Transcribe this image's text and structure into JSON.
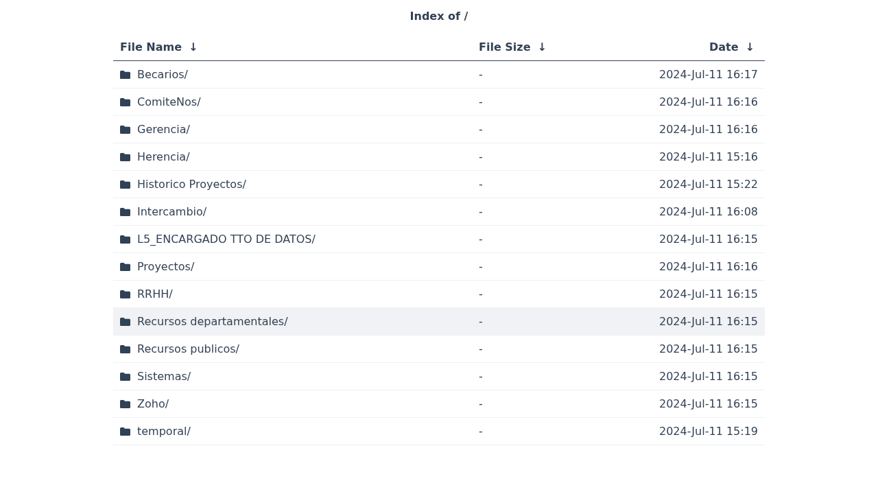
{
  "title": "Index of /",
  "table": {
    "columns": [
      {
        "label": "File Name",
        "sort": "↓"
      },
      {
        "label": "File Size",
        "sort": "↓"
      },
      {
        "label": "Date",
        "sort": "↓"
      }
    ],
    "rows": [
      {
        "name": "Becarios/",
        "size": "-",
        "date": "2024-Jul-11 16:17",
        "highlighted": false
      },
      {
        "name": "ComiteNos/",
        "size": "-",
        "date": "2024-Jul-11 16:16",
        "highlighted": false
      },
      {
        "name": "Gerencia/",
        "size": "-",
        "date": "2024-Jul-11 16:16",
        "highlighted": false
      },
      {
        "name": "Herencia/",
        "size": "-",
        "date": "2024-Jul-11 15:16",
        "highlighted": false
      },
      {
        "name": "Historico Proyectos/",
        "size": "-",
        "date": "2024-Jul-11 15:22",
        "highlighted": false
      },
      {
        "name": "Intercambio/",
        "size": "-",
        "date": "2024-Jul-11 16:08",
        "highlighted": false
      },
      {
        "name": "L5_ENCARGADO TTO DE DATOS/",
        "size": "-",
        "date": "2024-Jul-11 16:15",
        "highlighted": false
      },
      {
        "name": "Proyectos/",
        "size": "-",
        "date": "2024-Jul-11 16:16",
        "highlighted": false
      },
      {
        "name": "RRHH/",
        "size": "-",
        "date": "2024-Jul-11 16:15",
        "highlighted": false
      },
      {
        "name": "Recursos departamentales/",
        "size": "-",
        "date": "2024-Jul-11 16:15",
        "highlighted": true
      },
      {
        "name": "Recursos publicos/",
        "size": "-",
        "date": "2024-Jul-11 16:15",
        "highlighted": false
      },
      {
        "name": "Sistemas/",
        "size": "-",
        "date": "2024-Jul-11 16:15",
        "highlighted": false
      },
      {
        "name": "Zoho/",
        "size": "-",
        "date": "2024-Jul-11 16:15",
        "highlighted": false
      },
      {
        "name": "temporal/",
        "size": "-",
        "date": "2024-Jul-11 15:19",
        "highlighted": false
      }
    ]
  }
}
